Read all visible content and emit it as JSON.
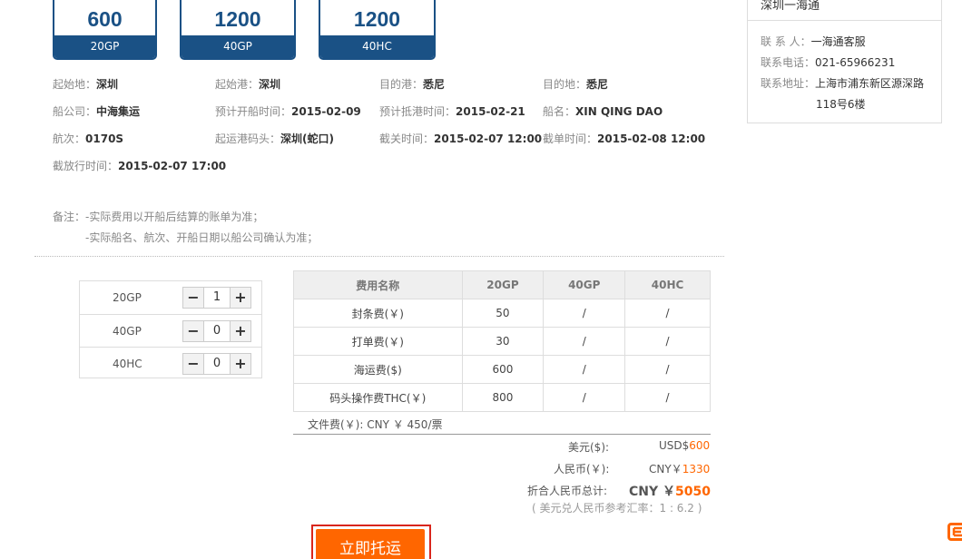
{
  "cards": [
    {
      "price": "600",
      "type": "20GP"
    },
    {
      "price": "1200",
      "type": "40GP"
    },
    {
      "price": "1200",
      "type": "40HC"
    }
  ],
  "info": {
    "origin": {
      "label": "起始地：",
      "value": "深圳"
    },
    "pol": {
      "label": "起始港：",
      "value": "深圳"
    },
    "pod": {
      "label": "目的港：",
      "value": "悉尼"
    },
    "dest": {
      "label": "目的地：",
      "value": "悉尼"
    },
    "carrier": {
      "label": "船公司：",
      "value": "中海集运"
    },
    "etd": {
      "label": "预计开船时间：",
      "value": "2015-02-09"
    },
    "eta": {
      "label": "预计抵港时间：",
      "value": "2015-02-21"
    },
    "vessel": {
      "label": "船名：",
      "value": "XIN QING DAO"
    },
    "voyage": {
      "label": "航次：",
      "value": "0170S"
    },
    "terminal": {
      "label": "起运港码头：",
      "value": "深圳(蛇口)"
    },
    "cutoff": {
      "label": "截关时间：",
      "value": "2015-02-07 12:00"
    },
    "si_cutoff": {
      "label": "截单时间：",
      "value": "2015-02-08 12:00"
    },
    "release": {
      "label": "截放行时间：",
      "value": "2015-02-07 17:00"
    }
  },
  "notes": {
    "label": "备注：",
    "line1": "-实际费用以开船后结算的账单为准；",
    "line2": "-实际船名、航次、开船日期以船公司确认为准；"
  },
  "quantities": [
    {
      "type": "20GP",
      "minus": "−",
      "value": "1",
      "plus": "+"
    },
    {
      "type": "40GP",
      "minus": "−",
      "value": "0",
      "plus": "+"
    },
    {
      "type": "40HC",
      "minus": "−",
      "value": "0",
      "plus": "+"
    }
  ],
  "fees": {
    "headers": [
      "费用名称",
      "20GP",
      "40GP",
      "40HC"
    ],
    "rows": [
      [
        "封条费(￥)",
        "50",
        "/",
        "/"
      ],
      [
        "打单费(￥)",
        "30",
        "/",
        "/"
      ],
      [
        "海运费($)",
        "600",
        "/",
        "/"
      ],
      [
        "码头操作费THC(￥)",
        "800",
        "/",
        "/"
      ]
    ],
    "doc_fee": "文件费(￥): CNY  ￥ 450/票"
  },
  "summary": {
    "usd_label": "美元($):",
    "usd_prefix": "USD$",
    "usd_value": "600",
    "cny_label": "人民币(￥):",
    "cny_prefix": "CNY￥",
    "cny_value": "1330",
    "total_label": "折合人民币总计:",
    "total_prefix": "CNY ￥",
    "total_value": "5050",
    "rate_note": "( 美元兑人民币参考汇率：1 : 6.2 )"
  },
  "ship_button": "立即托运",
  "contact": {
    "title": "深圳一海通",
    "person_label": "联 系 人：",
    "person": "一海通客服",
    "phone_label": "联系电话：",
    "phone": "021-65966231",
    "address_label": "联系地址：",
    "address1": "上海市浦东新区源深路",
    "address2": "118号6楼"
  },
  "colors": {
    "brand": "#1a5185",
    "accent": "#ff6600",
    "highlight_border": "#d9261c"
  }
}
